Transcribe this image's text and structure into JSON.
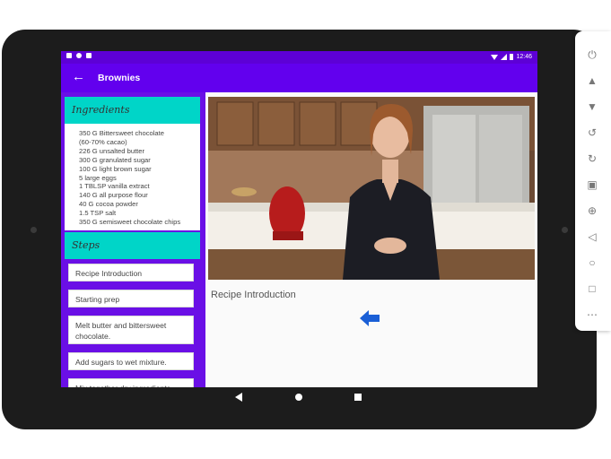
{
  "status_bar": {
    "time": "12:46",
    "icons": [
      "notification-icon",
      "globe-icon",
      "sd-card-icon",
      "wifi-icon",
      "signal-icon",
      "battery-icon"
    ]
  },
  "app_bar": {
    "back_icon": "arrow-left-icon",
    "title": "Brownies"
  },
  "ingredients": {
    "header": "Ingredients",
    "items": [
      "350 G Bittersweet chocolate",
      "(60-70% cacao)",
      "226 G unsalted butter",
      "300 G granulated sugar",
      "100 G light brown sugar",
      "5  large eggs",
      "1 TBLSP vanilla extract",
      "140 G all purpose flour",
      "40 G cocoa powder",
      "1.5 TSP salt",
      "350 G semisweet chocolate chips"
    ]
  },
  "steps": {
    "header": "Steps",
    "items": [
      "Recipe Introduction",
      "Starting prep",
      "Melt butter and bittersweet chocolate.",
      "Add sugars to wet mixture.",
      "Mix together dry ingredients."
    ]
  },
  "detail": {
    "step_title": "Recipe Introduction",
    "prev_icon": "arrow-left-icon"
  },
  "nav_bar": {
    "icons": [
      "back-triangle-icon",
      "home-circle-icon",
      "recents-square-icon"
    ]
  },
  "emulator_sidebar": {
    "icons": [
      "power-icon",
      "volume-up-icon",
      "volume-down-icon",
      "rotate-left-icon",
      "rotate-right-icon",
      "camera-icon",
      "zoom-icon",
      "back-icon",
      "home-icon",
      "overview-icon",
      "more-icon"
    ]
  },
  "colors": {
    "status_bar": "#5d00d6",
    "app_bar": "#6200ee",
    "left_pane": "#6a0fe6",
    "section_header": "#00d5c8",
    "prev_arrow": "#1a5fd6"
  }
}
